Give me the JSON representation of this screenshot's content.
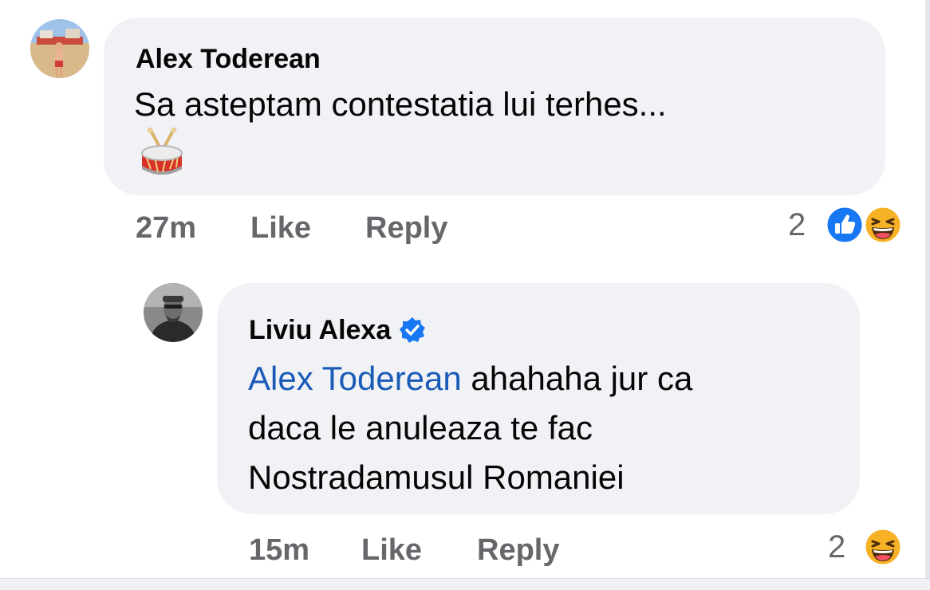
{
  "comments": [
    {
      "author": "Alex Toderean",
      "text": "Sa asteptam contestatia lui terhes...",
      "emoji": "drum-icon",
      "time": "27m",
      "like_label": "Like",
      "reply_label": "Reply",
      "reaction_count": "2",
      "reactions": [
        "like-icon",
        "haha-icon"
      ]
    },
    {
      "author": "Liviu Alexa",
      "verified": true,
      "mention": "Alex Toderean",
      "text_line1": " ahahaha jur ca",
      "text_line2": "daca le anuleaza te fac",
      "text_line3": "Nostradamusul Romaniei",
      "time": "15m",
      "like_label": "Like",
      "reply_label": "Reply",
      "reaction_count": "2",
      "reactions": [
        "haha-icon"
      ]
    }
  ],
  "colors": {
    "bubble": "#f0f2f5",
    "meta_text": "#65676b",
    "mention": "#1a5bb8",
    "like_blue": "#1877f2",
    "haha_yellow": "#f7b125"
  }
}
